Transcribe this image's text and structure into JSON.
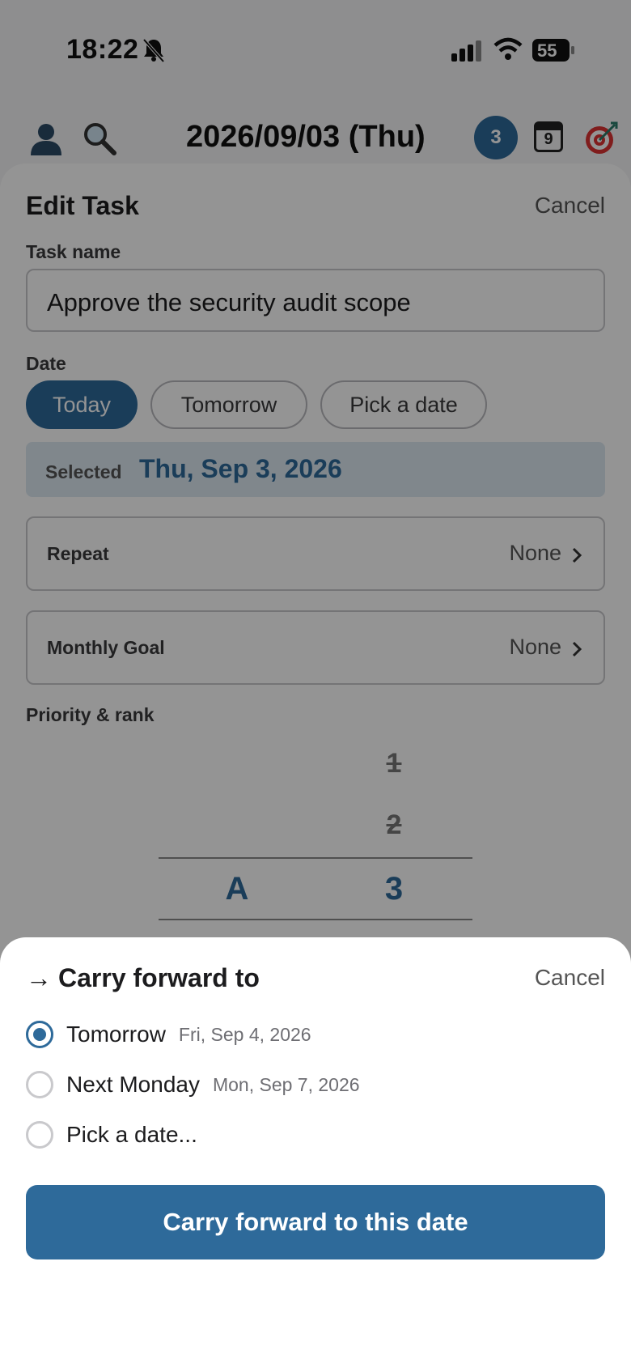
{
  "status_bar": {
    "time": "18:22",
    "battery": "55",
    "icons": [
      "bell-slash-icon",
      "signal-icon",
      "wifi-icon",
      "battery-icon"
    ]
  },
  "app_header": {
    "date_title": "2026/09/03 (Thu)",
    "badge_count": "3",
    "calendar_day": "9",
    "icons": [
      "profile-icon",
      "search-icon",
      "calendar-icon",
      "target-icon"
    ]
  },
  "edit_task": {
    "title": "Edit Task",
    "cancel": "Cancel",
    "task_name_label": "Task name",
    "task_name_value": "Approve the security audit scope",
    "date_label": "Date",
    "date_chips": [
      "Today",
      "Tomorrow",
      "Pick a date"
    ],
    "selected_label": "Selected",
    "selected_value": "Thu, Sep 3, 2026",
    "repeat_label": "Repeat",
    "repeat_value": "None",
    "goal_label": "Monthly Goal",
    "goal_value": "None",
    "priority_label": "Priority & rank",
    "priority_selected": "A",
    "rank_items": [
      "1",
      "2"
    ],
    "rank_selected": "3"
  },
  "carry_forward": {
    "arrow": "→",
    "title": "Carry forward to",
    "cancel": "Cancel",
    "options": [
      {
        "label": "Tomorrow",
        "sub": "Fri, Sep 4, 2026",
        "selected": true
      },
      {
        "label": "Next Monday",
        "sub": "Mon, Sep 7, 2026",
        "selected": false
      },
      {
        "label": "Pick a date...",
        "sub": "",
        "selected": false
      }
    ],
    "button": "Carry forward to this date"
  },
  "colors": {
    "accent": "#2e6a9a",
    "selected_bg": "#dde8f2",
    "overlay": "rgba(0,0,0,0.42)"
  }
}
